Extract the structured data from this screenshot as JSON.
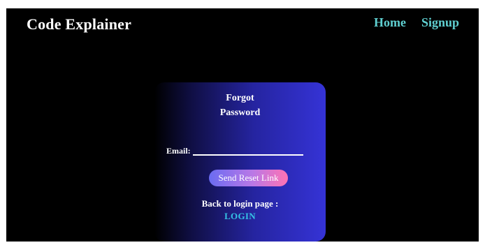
{
  "header": {
    "brand": "Code Explainer",
    "nav": {
      "home": "Home",
      "signup": "Signup"
    }
  },
  "form": {
    "title_line1": "Forgot",
    "title_line2": "Password",
    "email_label": "Email:",
    "email_value": "",
    "send_button": "Send Reset Link",
    "back_text": "Back to login page :",
    "login_link": "LOGIN"
  },
  "colors": {
    "background": "#000000",
    "nav_link": "#5fcfd0",
    "card_gradient_end": "#3533d6",
    "button_gradient": [
      "#6a6cf2",
      "#ff72b4"
    ],
    "login_link": "#35c3e5"
  }
}
